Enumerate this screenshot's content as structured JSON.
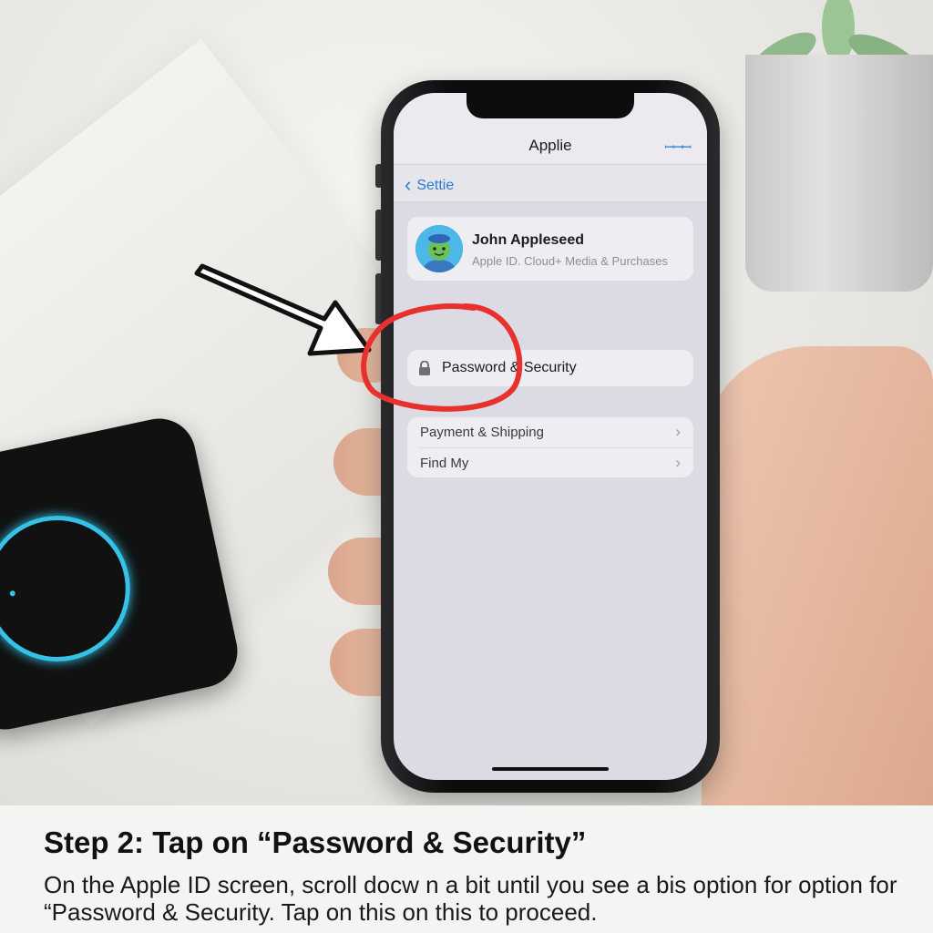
{
  "phone": {
    "nav_title": "Applie",
    "nav_icon": "ꟷꟷꟷ",
    "back_label": "Settie",
    "profile": {
      "name": "John Appleseed",
      "subtitle": "Apple ID. Cloud+ Media & Purchases"
    },
    "password_row": {
      "label": "Password & Security",
      "icon": "lock-icon"
    },
    "list_rows": [
      {
        "label": "Payment & Shipping"
      },
      {
        "label": "Find My"
      }
    ]
  },
  "annotation": {
    "arrow_color": "#111111",
    "circle_color": "#e8302c"
  },
  "caption": {
    "title": "Step 2: Tap on “Password & Security”",
    "body": "On the Apple ID screen, scroll docw n a bit until you see a bis option for option for “Password & Security. Tap on this on this to proceed."
  },
  "colors": {
    "accent": "#2a7bd6",
    "charger_glow": "#35c2e6"
  }
}
